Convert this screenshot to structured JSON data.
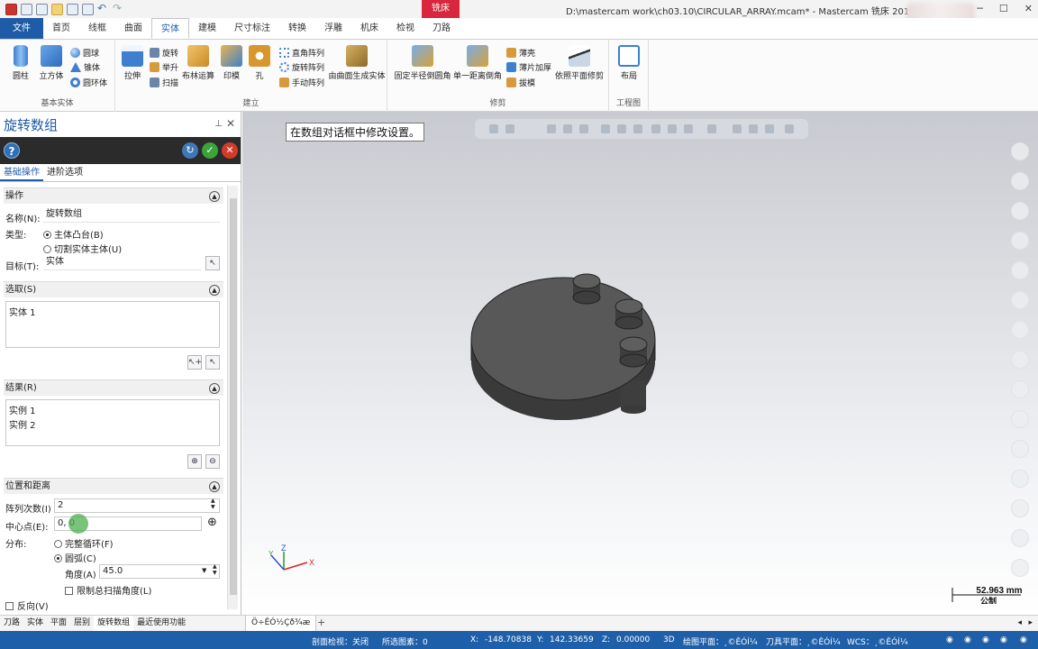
{
  "window": {
    "context_tab": "铣床",
    "title": "D:\\mastercam work\\ch03.10\\CIRCULAR_ARRAY.mcam* - Mastercam 铣床 2019"
  },
  "tabs": [
    "文件",
    "首页",
    "线框",
    "曲面",
    "实体",
    "建模",
    "尺寸标注",
    "转换",
    "浮雕",
    "机床",
    "检视",
    "刀路"
  ],
  "active_tab": "实体",
  "ribbon": {
    "basic_solids": {
      "label": "基本实体",
      "cylinder": "圆柱",
      "cube": "立方体",
      "sphere": "圆球",
      "cone": "锥体",
      "torus": "圆环体"
    },
    "create": {
      "label": "建立",
      "extrude": "拉伸",
      "revolve": "旋转",
      "loft": "举升",
      "sweep": "扫描",
      "boolean": "布林运算",
      "imprint": "印模",
      "hole": "孔",
      "rect_array": "直角阵列",
      "rotate_array": "旋转阵列",
      "manual_array": "手动阵列",
      "from_surfaces": "由曲面生成实体"
    },
    "modify": {
      "label": "修剪",
      "fixed_fillet": "固定半径倒圆角",
      "chamfer": "单一距离倒角",
      "shell": "薄壳",
      "thicken": "薄片加厚",
      "draft": "拔模",
      "trim_plane": "依照平面修剪"
    },
    "drawing": {
      "label": "工程图",
      "layout": "布局"
    }
  },
  "panel": {
    "title": "旋转数组",
    "sub_tabs": [
      "基础操作",
      "进阶选项"
    ],
    "operation": {
      "header": "操作",
      "name_label": "名称(N):",
      "name_value": "旋转数组",
      "type_label": "类型:",
      "type_opt1": "主体凸台(B)",
      "type_opt2": "切割实体主体(U)",
      "target_label": "目标(T):",
      "target_value": "实体"
    },
    "selection": {
      "header": "选取(S)",
      "items": [
        "实体 1"
      ]
    },
    "result": {
      "header": "结果(R)",
      "items": [
        "实例 1",
        "实例 2"
      ]
    },
    "position": {
      "header": "位置和距离",
      "count_label": "阵列次数(I)",
      "count_value": "2",
      "center_label": "中心点(E):",
      "center_value": "0, 0",
      "dist_label": "分布:",
      "full_circle": "完整循环(F)",
      "arc": "圆弧(C)",
      "angle_label": "角度(A)",
      "angle_value": "45.0",
      "limit_label": "限制总扫描角度(L)"
    },
    "reverse_label": "反向(V)"
  },
  "bottom_tabs": [
    "刀路",
    "实体",
    "平面",
    "层别",
    "旋转数组",
    "最近使用功能"
  ],
  "viewport_tab": "Ö÷ÊÓ½Çð¾æ",
  "viewport": {
    "hint": "在数组对话框中修改设置。",
    "scale_value": "52.963 mm",
    "scale_unit": "公制",
    "axis_z": "Z",
    "axis_y": "Y",
    "axis_x": "X"
  },
  "status": {
    "section_view": "剖面检视：关闭",
    "selected": "所选图素：0",
    "x_label": "X:",
    "x_value": "-148.70838",
    "y_label": "Y:",
    "y_value": "142.33659",
    "z_label": "Z:",
    "z_value": "0.00000",
    "mode": "3D",
    "draw_plane": "绘图平面：¸©ÊÓÍ¼",
    "tool_plane": "刀具平面：¸©ÊÓÍ¼",
    "wcs": "WCS：¸©ÊÓÍ¼"
  }
}
